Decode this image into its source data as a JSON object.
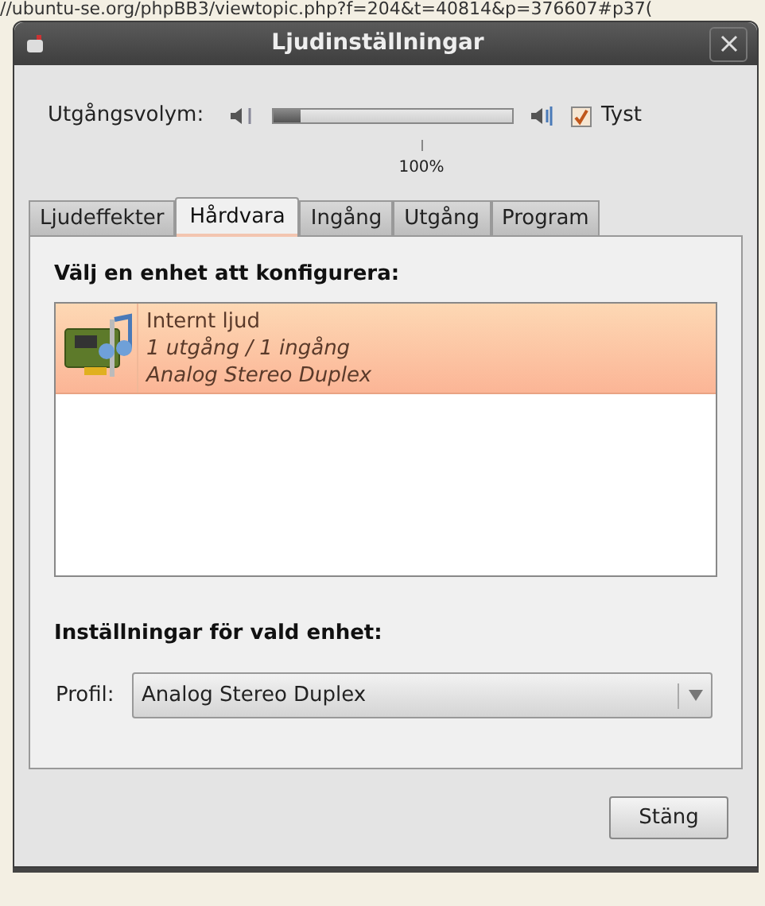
{
  "background": {
    "url_text": "//ubuntu-se.org/phpBB3/viewtopic.php?f=204&t=40814&p=376607#p37("
  },
  "window": {
    "title": "Ljudinställningar"
  },
  "volume": {
    "label": "Utgångsvolym:",
    "level": 0.11,
    "mark": "100%",
    "mute_label": "Tyst",
    "muted": true
  },
  "tabs": [
    {
      "label": "Ljudeffekter",
      "selected": false
    },
    {
      "label": "Hårdvara",
      "selected": true
    },
    {
      "label": "Ingång",
      "selected": false
    },
    {
      "label": "Utgång",
      "selected": false
    },
    {
      "label": "Program",
      "selected": false
    }
  ],
  "devices_heading": "Välj en enhet att konfigurera:",
  "devices": [
    {
      "name": "Internt ljud",
      "ports": "1 utgång / 1 ingång",
      "profile": "Analog Stereo Duplex",
      "selected": true
    }
  ],
  "settings_heading": "Inställningar för vald enhet:",
  "profile": {
    "label": "Profil:",
    "value": "Analog Stereo Duplex"
  },
  "buttons": [
    "Stäng"
  ]
}
